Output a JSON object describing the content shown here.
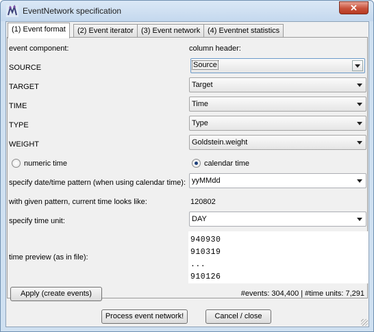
{
  "window": {
    "title": "EventNetwork specification",
    "close_glyph": "✕"
  },
  "tabs": [
    {
      "label": "(1) Event format",
      "active": true
    },
    {
      "label": "(2) Event iterator",
      "active": false
    },
    {
      "label": "(3) Event network",
      "active": false
    },
    {
      "label": "(4) Eventnet statistics",
      "active": false
    }
  ],
  "format": {
    "component_header": "event component:",
    "column_header": "column header:",
    "rows": [
      {
        "label": "SOURCE",
        "value": "Source"
      },
      {
        "label": "TARGET",
        "value": "Target"
      },
      {
        "label": "TIME",
        "value": "Time"
      },
      {
        "label": "TYPE",
        "value": "Type"
      },
      {
        "label": "WEIGHT",
        "value": "Goldstein.weight"
      }
    ],
    "radio_numeric": "numeric time",
    "radio_calendar": "calendar time",
    "selected_time_mode": "calendar time",
    "pattern_label": "specify date/time pattern (when using calendar time):",
    "pattern_value": "yyMMdd",
    "current_time_label": "with given pattern, current time looks like:",
    "current_time_value": "120802",
    "time_unit_label": "specify time unit:",
    "time_unit_value": "DAY",
    "preview_label": "time preview (as in file):",
    "preview_lines": [
      "940930",
      "910319",
      "...",
      "910126"
    ],
    "apply_button": "Apply (create events)",
    "stats_text": "#events: 304,400 | #time units: 7,291"
  },
  "footer": {
    "process_button": "Process event network!",
    "cancel_button": "Cancel / close"
  }
}
